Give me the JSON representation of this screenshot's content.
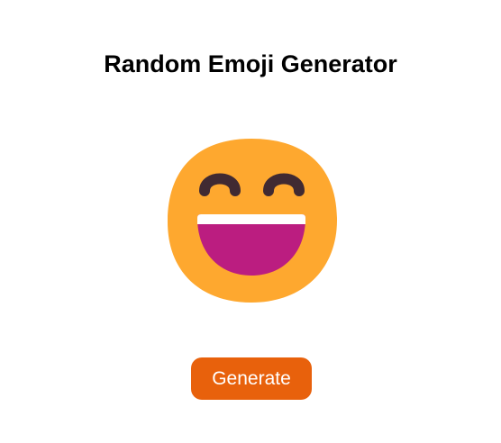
{
  "page": {
    "title": "Random Emoji Generator"
  },
  "emoji": {
    "icon": "grinning-face-with-smiling-eyes-icon"
  },
  "generate_button": {
    "label": "Generate"
  },
  "colors": {
    "button_bg": "#e8610c",
    "emoji_face": "#fea82f",
    "emoji_eyes": "#402a32",
    "emoji_mouth": "#bb1d80",
    "emoji_teeth": "#ffffff"
  }
}
